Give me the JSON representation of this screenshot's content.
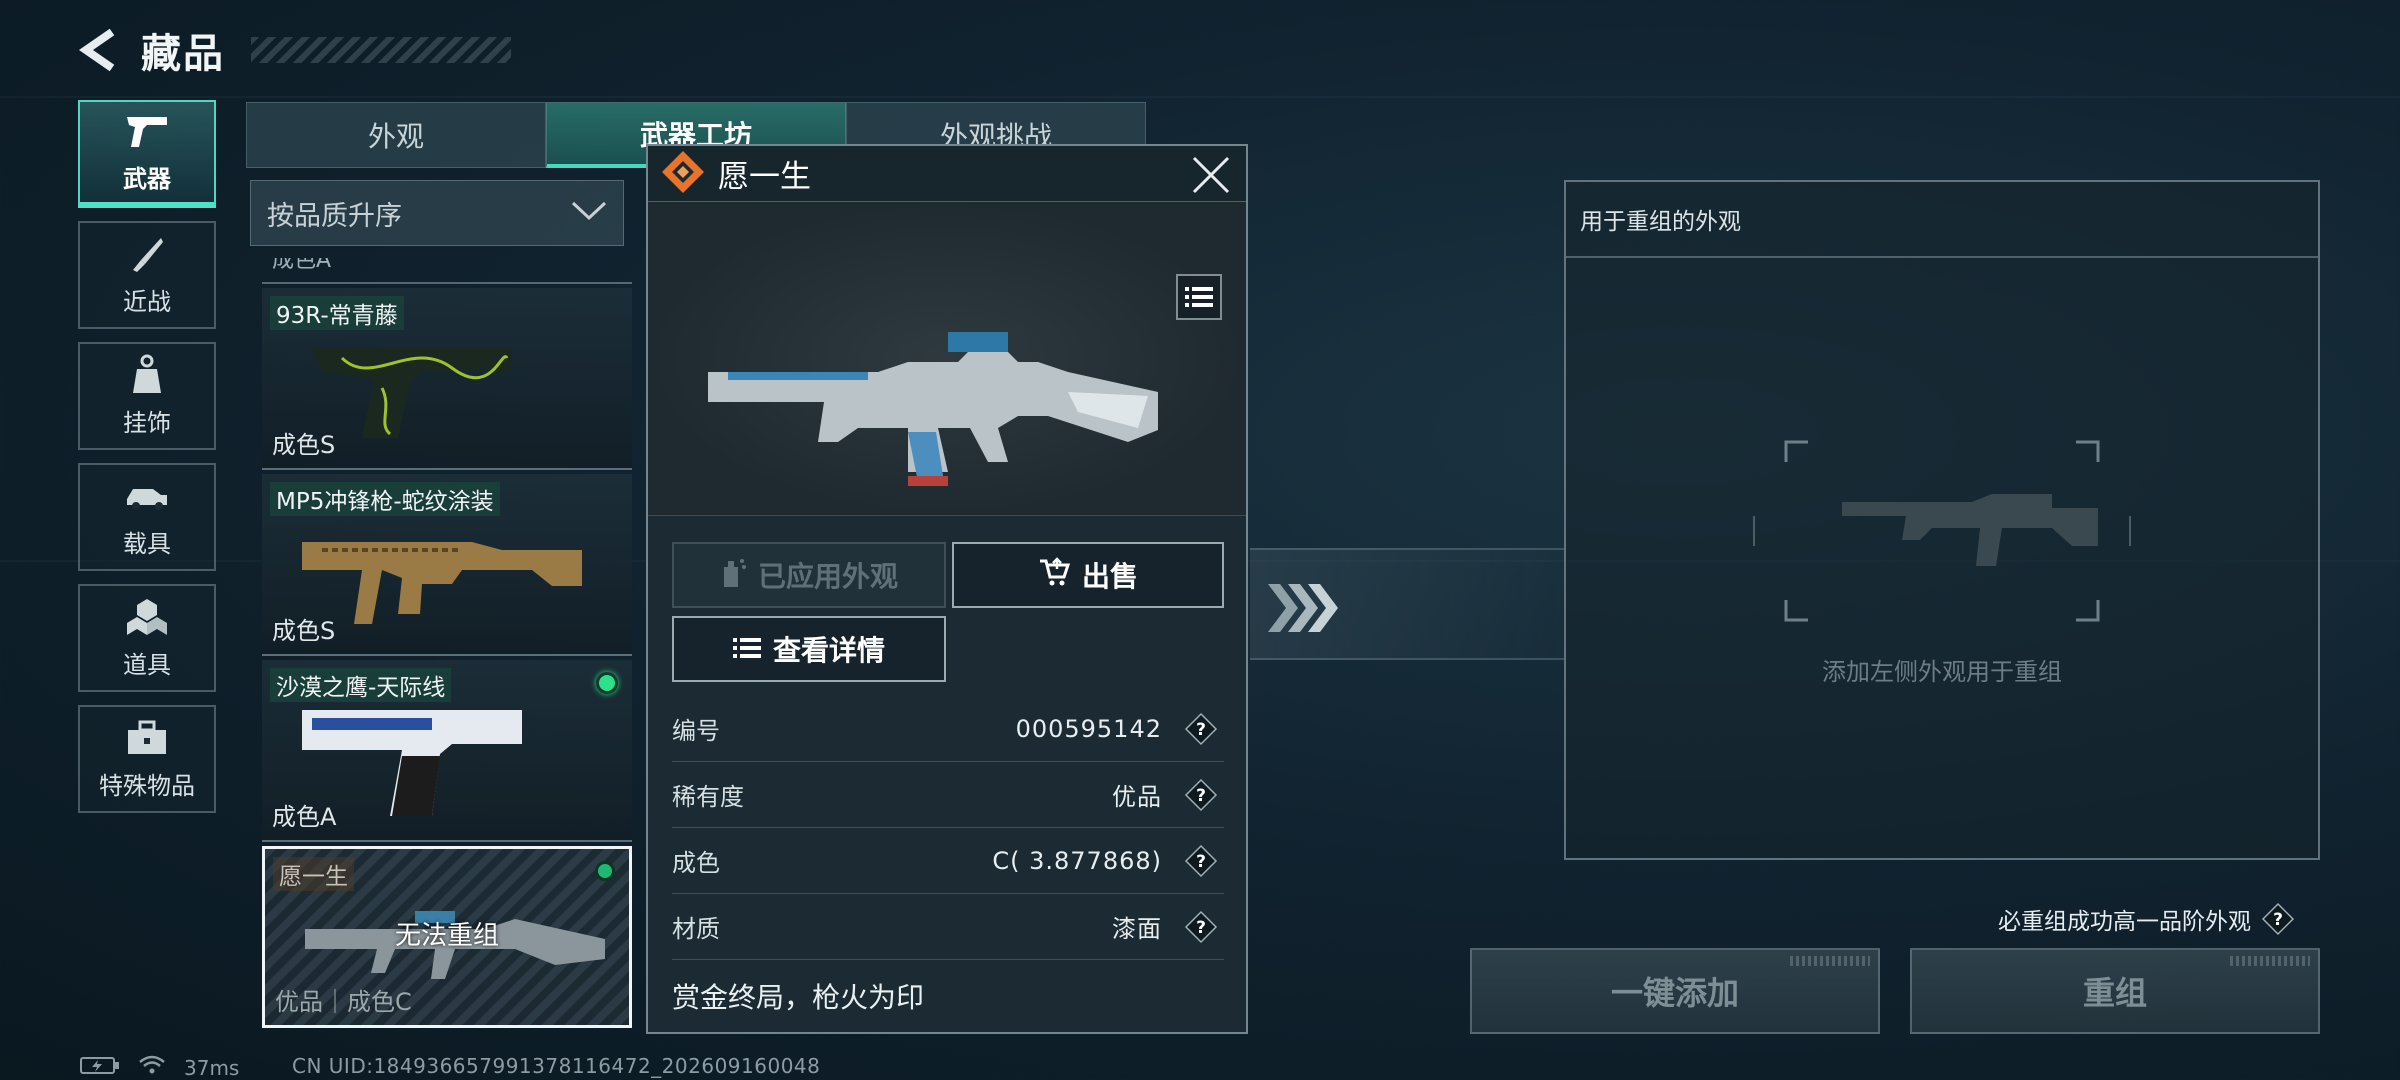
{
  "header": {
    "title": "藏品"
  },
  "sidebar": {
    "items": [
      {
        "label": "武器",
        "icon": "pistol-icon",
        "active": true
      },
      {
        "label": "近战",
        "icon": "knife-icon",
        "active": false
      },
      {
        "label": "挂饰",
        "icon": "charm-icon",
        "active": false
      },
      {
        "label": "载具",
        "icon": "vehicle-icon",
        "active": false
      },
      {
        "label": "道具",
        "icon": "cubes-icon",
        "active": false
      },
      {
        "label": "特殊物品",
        "icon": "toolbox-icon",
        "active": false
      }
    ]
  },
  "tabs": [
    {
      "label": "外观",
      "active": false
    },
    {
      "label": "武器工坊",
      "active": true
    },
    {
      "label": "外观挑战",
      "active": false
    }
  ],
  "sort": {
    "selected": "按品质升序"
  },
  "list": {
    "partial_top_label": "成色A",
    "items": [
      {
        "name": "93R-常青藤",
        "grade": "成色S",
        "equipped": false
      },
      {
        "name": "MP5冲锋枪-蛇纹涂装",
        "grade": "成色S",
        "equipped": false
      },
      {
        "name": "沙漠之鹰-天际线",
        "grade": "成色A",
        "equipped": true
      },
      {
        "name": "愿一生",
        "grade": "优品｜成色C",
        "overlay": "无法重组",
        "equipped": true,
        "selected": true
      }
    ]
  },
  "popup": {
    "title": "愿一生",
    "buttons": {
      "applied": "已应用外观",
      "sell": "出售",
      "detail": "查看详情"
    },
    "props": [
      {
        "label": "编号",
        "value": "000595142"
      },
      {
        "label": "稀有度",
        "value": "优品"
      },
      {
        "label": "成色",
        "value": "C( 3.877868)"
      },
      {
        "label": "材质",
        "value": "漆面"
      }
    ],
    "slogan": "赏金终局，枪火为印"
  },
  "recombine": {
    "panel_title": "用于重组的外观",
    "hint": "添加左侧外观用于重组",
    "note": "必重组成功高一品阶外观",
    "btn_add": "一键添加",
    "btn_recombine": "重组"
  },
  "status": {
    "ping": "37ms",
    "uid": "CN UID:184936657991378116472_202609160048"
  },
  "colors": {
    "accent": "#4fe0c6",
    "equipped": "#2ee08a",
    "brand_orange": "#e8742a"
  }
}
